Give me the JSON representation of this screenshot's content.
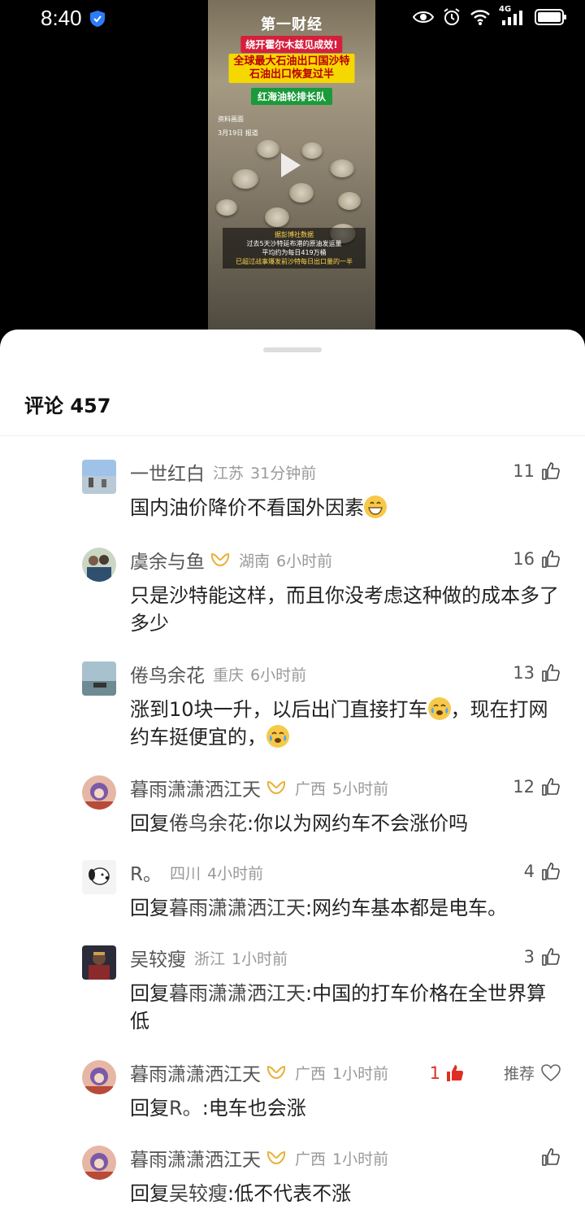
{
  "status_bar": {
    "time": "8:40",
    "network": "4G"
  },
  "video": {
    "brand": "第一财经",
    "tag1": "绕开霍尔木兹见成效!",
    "tag2_line1": "全球最大石油出口国沙特",
    "tag2_line2": "石油出口恢复过半",
    "tag3": "红海油轮排长队",
    "source_line1": "资料画面",
    "source_line2": "3月19日 报道",
    "caption_line1": "据彭博社数据",
    "caption_line2": "过去5天沙特延布港的原油发运量",
    "caption_line3": "平均约为每日419万桶",
    "caption_line4": "已超过战事爆发前沙特每日出口量的一半"
  },
  "comments_header": {
    "title": "评论 457"
  },
  "comments": [
    {
      "user": "一世红白",
      "vip": false,
      "location": "江苏",
      "time": "31分钟前",
      "likes": "11",
      "text": "国内油价降价不看国外因素",
      "emoji": "grin-emoji"
    },
    {
      "user": "虞余与鱼",
      "vip": true,
      "location": "湖南",
      "time": "6小时前",
      "likes": "16",
      "text": "只是沙特能这样，而且你没考虑这种做的成本多了多少"
    },
    {
      "user": "倦鸟余花",
      "vip": false,
      "location": "重庆",
      "time": "6小时前",
      "likes": "13",
      "text_a": "涨到10块一升，以后出门直接打车",
      "text_b": "，现在打网约车挺便宜的，",
      "emoji": "crying-face-emoji"
    },
    {
      "user": "暮雨潇潇洒江天",
      "vip": true,
      "location": "广西",
      "time": "5小时前",
      "likes": "12",
      "reply_prefix": "回复",
      "reply_to": "倦鸟余花",
      "text": ":你以为网约车不会涨价吗"
    },
    {
      "user": "R。",
      "vip": false,
      "location": "四川",
      "time": "4小时前",
      "likes": "4",
      "reply_prefix": "回复",
      "reply_to": "暮雨潇潇洒江天",
      "text": ":网约车基本都是电车。"
    },
    {
      "user": "吴较瘦",
      "vip": false,
      "location": "浙江",
      "time": "1小时前",
      "likes": "3",
      "reply_prefix": "回复",
      "reply_to": "暮雨潇潇洒江天",
      "text": ":中国的打车价格在全世界算低"
    },
    {
      "user": "暮雨潇潇洒江天",
      "vip": true,
      "location": "广西",
      "time": "1小时前",
      "likes": "1",
      "liked": true,
      "recommend_label": "推荐",
      "reply_prefix": "回复",
      "reply_to": "R。",
      "text": ":电车也会涨"
    },
    {
      "user": "暮雨潇潇洒江天",
      "vip": true,
      "location": "广西",
      "time": "1小时前",
      "likes": "",
      "reply_prefix": "回复",
      "reply_to": "吴较瘦",
      "text": ":低不代表不涨"
    }
  ],
  "colors": {
    "accent_red": "#e02e24",
    "vip_gold": "#e8b23a"
  }
}
